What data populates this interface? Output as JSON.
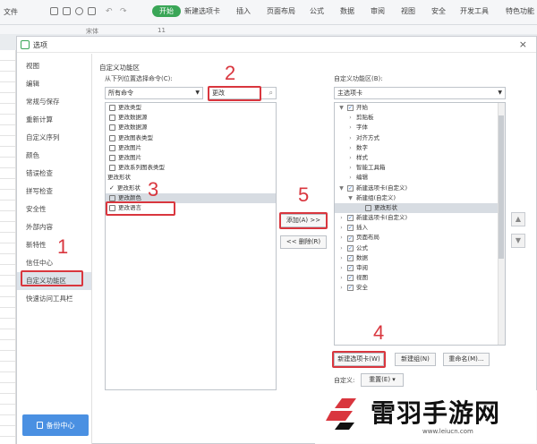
{
  "ribbon": {
    "file_menu": "文件",
    "tabs": [
      "开始",
      "新建选项卡",
      "插入",
      "页面布局",
      "公式",
      "数据",
      "审阅",
      "视图",
      "安全",
      "开发工具",
      "特色功能"
    ],
    "active_tab_index": 0,
    "font_name": "宋体",
    "font_size": "11"
  },
  "dialog": {
    "title": "选项",
    "close_glyph": "×",
    "sidebar": {
      "items": [
        "视图",
        "编辑",
        "常规与保存",
        "重新计算",
        "自定义序列",
        "颜色",
        "错误检查",
        "拼写检查",
        "安全性",
        "外部内容",
        "新特性",
        "信任中心",
        "自定义功能区",
        "快速访问工具栏"
      ],
      "selected_index": 12,
      "help_button": "备份中心"
    },
    "section_title": "自定义功能区",
    "left": {
      "label": "从下列位置选择命令(C):",
      "source_select": "所有命令",
      "search_value": "更改",
      "commands": [
        "更改类型",
        "更改数据源",
        "更改数据源",
        "更改图表类型",
        "更改图片",
        "更改图片",
        "更改系列图表类型",
        "更改形状",
        "更改形状",
        "更改颜色",
        "更改语言"
      ],
      "command_types": [
        "item",
        "item",
        "item",
        "item",
        "item",
        "item",
        "item",
        "header",
        "check",
        "selected",
        "item"
      ]
    },
    "middle": {
      "add_button": "添加(A) >>",
      "remove_button": "<< 删除(R)"
    },
    "right": {
      "label": "自定义功能区(B):",
      "tabs_select": "主选项卡",
      "tree": [
        {
          "text": "开始",
          "level": 0,
          "exp": "▼",
          "checked": true
        },
        {
          "text": "剪贴板",
          "level": 1,
          "exp": "›",
          "checked": null
        },
        {
          "text": "字体",
          "level": 1,
          "exp": "›",
          "checked": null
        },
        {
          "text": "对齐方式",
          "level": 1,
          "exp": "›",
          "checked": null
        },
        {
          "text": "数字",
          "level": 1,
          "exp": "›",
          "checked": null
        },
        {
          "text": "样式",
          "level": 1,
          "exp": "›",
          "checked": null
        },
        {
          "text": "智能工具箱",
          "level": 1,
          "exp": "›",
          "checked": null
        },
        {
          "text": "编辑",
          "level": 1,
          "exp": "›",
          "checked": null
        },
        {
          "text": "新建选项卡(自定义)",
          "level": 0,
          "exp": "▼",
          "checked": true
        },
        {
          "text": "新建组(自定义)",
          "level": 1,
          "exp": "▼",
          "checked": null
        },
        {
          "text": "更改形状",
          "level": 2,
          "exp": "",
          "checked": null,
          "selected": true
        },
        {
          "text": "新建选项卡(自定义)",
          "level": 0,
          "exp": "›",
          "checked": true
        },
        {
          "text": "插入",
          "level": 0,
          "exp": "›",
          "checked": true
        },
        {
          "text": "页面布局",
          "level": 0,
          "exp": "›",
          "checked": true
        },
        {
          "text": "公式",
          "level": 0,
          "exp": "›",
          "checked": true
        },
        {
          "text": "数据",
          "level": 0,
          "exp": "›",
          "checked": true
        },
        {
          "text": "审阅",
          "level": 0,
          "exp": "›",
          "checked": true
        },
        {
          "text": "视图",
          "level": 0,
          "exp": "›",
          "checked": true
        },
        {
          "text": "安全",
          "level": 0,
          "exp": "›",
          "checked": true
        }
      ],
      "new_tab_button": "新建选项卡(W)",
      "new_group_button": "新建组(N)",
      "rename_button": "重命名(M)...",
      "custom_label": "自定义:",
      "reset_button": "重置(E) ▾",
      "move_up": "▲",
      "move_down": "▼"
    },
    "steps": [
      "1",
      "2",
      "3",
      "4",
      "5"
    ]
  },
  "watermark": {
    "text": "雷羽手游网",
    "url": "www.leiucn.com"
  },
  "colors": {
    "accent_green": "#3aa657",
    "annotation_red": "#d9363e",
    "help_blue": "#4a90e2"
  }
}
